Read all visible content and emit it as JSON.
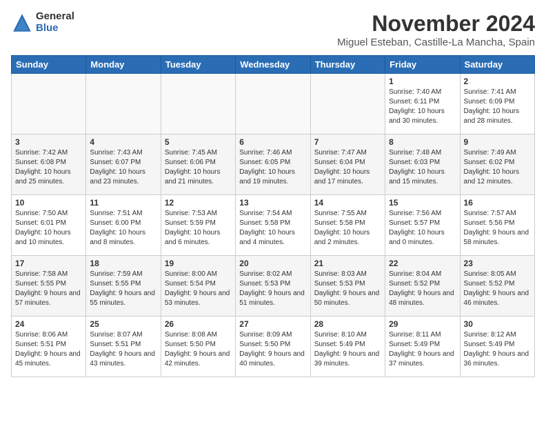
{
  "header": {
    "logo_general": "General",
    "logo_blue": "Blue",
    "month_title": "November 2024",
    "location": "Miguel Esteban, Castille-La Mancha, Spain"
  },
  "weekdays": [
    "Sunday",
    "Monday",
    "Tuesday",
    "Wednesday",
    "Thursday",
    "Friday",
    "Saturday"
  ],
  "weeks": [
    [
      {
        "day": "",
        "info": ""
      },
      {
        "day": "",
        "info": ""
      },
      {
        "day": "",
        "info": ""
      },
      {
        "day": "",
        "info": ""
      },
      {
        "day": "",
        "info": ""
      },
      {
        "day": "1",
        "info": "Sunrise: 7:40 AM\nSunset: 6:11 PM\nDaylight: 10 hours and 30 minutes."
      },
      {
        "day": "2",
        "info": "Sunrise: 7:41 AM\nSunset: 6:09 PM\nDaylight: 10 hours and 28 minutes."
      }
    ],
    [
      {
        "day": "3",
        "info": "Sunrise: 7:42 AM\nSunset: 6:08 PM\nDaylight: 10 hours and 25 minutes."
      },
      {
        "day": "4",
        "info": "Sunrise: 7:43 AM\nSunset: 6:07 PM\nDaylight: 10 hours and 23 minutes."
      },
      {
        "day": "5",
        "info": "Sunrise: 7:45 AM\nSunset: 6:06 PM\nDaylight: 10 hours and 21 minutes."
      },
      {
        "day": "6",
        "info": "Sunrise: 7:46 AM\nSunset: 6:05 PM\nDaylight: 10 hours and 19 minutes."
      },
      {
        "day": "7",
        "info": "Sunrise: 7:47 AM\nSunset: 6:04 PM\nDaylight: 10 hours and 17 minutes."
      },
      {
        "day": "8",
        "info": "Sunrise: 7:48 AM\nSunset: 6:03 PM\nDaylight: 10 hours and 15 minutes."
      },
      {
        "day": "9",
        "info": "Sunrise: 7:49 AM\nSunset: 6:02 PM\nDaylight: 10 hours and 12 minutes."
      }
    ],
    [
      {
        "day": "10",
        "info": "Sunrise: 7:50 AM\nSunset: 6:01 PM\nDaylight: 10 hours and 10 minutes."
      },
      {
        "day": "11",
        "info": "Sunrise: 7:51 AM\nSunset: 6:00 PM\nDaylight: 10 hours and 8 minutes."
      },
      {
        "day": "12",
        "info": "Sunrise: 7:53 AM\nSunset: 5:59 PM\nDaylight: 10 hours and 6 minutes."
      },
      {
        "day": "13",
        "info": "Sunrise: 7:54 AM\nSunset: 5:58 PM\nDaylight: 10 hours and 4 minutes."
      },
      {
        "day": "14",
        "info": "Sunrise: 7:55 AM\nSunset: 5:58 PM\nDaylight: 10 hours and 2 minutes."
      },
      {
        "day": "15",
        "info": "Sunrise: 7:56 AM\nSunset: 5:57 PM\nDaylight: 10 hours and 0 minutes."
      },
      {
        "day": "16",
        "info": "Sunrise: 7:57 AM\nSunset: 5:56 PM\nDaylight: 9 hours and 58 minutes."
      }
    ],
    [
      {
        "day": "17",
        "info": "Sunrise: 7:58 AM\nSunset: 5:55 PM\nDaylight: 9 hours and 57 minutes."
      },
      {
        "day": "18",
        "info": "Sunrise: 7:59 AM\nSunset: 5:55 PM\nDaylight: 9 hours and 55 minutes."
      },
      {
        "day": "19",
        "info": "Sunrise: 8:00 AM\nSunset: 5:54 PM\nDaylight: 9 hours and 53 minutes."
      },
      {
        "day": "20",
        "info": "Sunrise: 8:02 AM\nSunset: 5:53 PM\nDaylight: 9 hours and 51 minutes."
      },
      {
        "day": "21",
        "info": "Sunrise: 8:03 AM\nSunset: 5:53 PM\nDaylight: 9 hours and 50 minutes."
      },
      {
        "day": "22",
        "info": "Sunrise: 8:04 AM\nSunset: 5:52 PM\nDaylight: 9 hours and 48 minutes."
      },
      {
        "day": "23",
        "info": "Sunrise: 8:05 AM\nSunset: 5:52 PM\nDaylight: 9 hours and 46 minutes."
      }
    ],
    [
      {
        "day": "24",
        "info": "Sunrise: 8:06 AM\nSunset: 5:51 PM\nDaylight: 9 hours and 45 minutes."
      },
      {
        "day": "25",
        "info": "Sunrise: 8:07 AM\nSunset: 5:51 PM\nDaylight: 9 hours and 43 minutes."
      },
      {
        "day": "26",
        "info": "Sunrise: 8:08 AM\nSunset: 5:50 PM\nDaylight: 9 hours and 42 minutes."
      },
      {
        "day": "27",
        "info": "Sunrise: 8:09 AM\nSunset: 5:50 PM\nDaylight: 9 hours and 40 minutes."
      },
      {
        "day": "28",
        "info": "Sunrise: 8:10 AM\nSunset: 5:49 PM\nDaylight: 9 hours and 39 minutes."
      },
      {
        "day": "29",
        "info": "Sunrise: 8:11 AM\nSunset: 5:49 PM\nDaylight: 9 hours and 37 minutes."
      },
      {
        "day": "30",
        "info": "Sunrise: 8:12 AM\nSunset: 5:49 PM\nDaylight: 9 hours and 36 minutes."
      }
    ]
  ]
}
